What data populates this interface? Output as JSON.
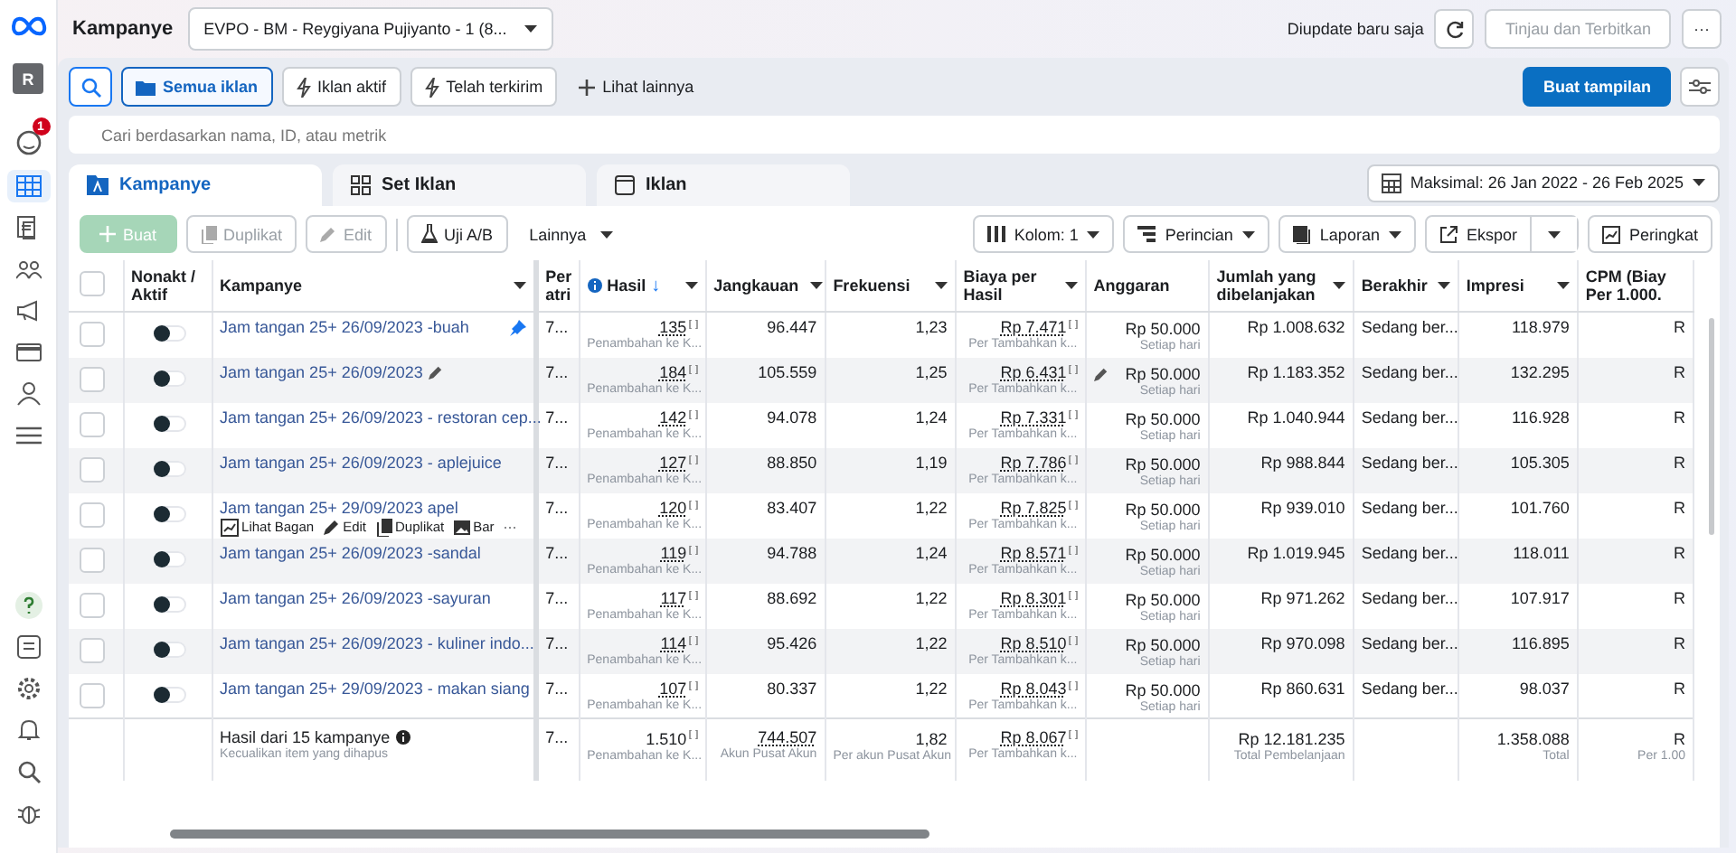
{
  "header": {
    "title": "Kampanye",
    "account": "EVPO - BM - Reygiyana Pujiyanto - 1 (8...",
    "status": "Diupdate baru saja",
    "publish": {
      "label": "Tinjau dan Terbitkan",
      "disabled": true
    },
    "more": "···"
  },
  "sidebar": {
    "avatar": "R",
    "badge": "1",
    "items": [
      {
        "kind": "notify",
        "selected": false
      },
      {
        "kind": "table",
        "selected": true
      },
      {
        "kind": "pages",
        "selected": false
      },
      {
        "kind": "people",
        "selected": false
      },
      {
        "kind": "megaphone",
        "selected": false
      },
      {
        "kind": "card",
        "selected": false
      },
      {
        "kind": "audience",
        "selected": false
      },
      {
        "kind": "menu",
        "selected": false
      }
    ],
    "bottom": [
      {
        "kind": "help"
      },
      {
        "kind": "report"
      },
      {
        "kind": "settings"
      },
      {
        "kind": "bell"
      },
      {
        "kind": "search"
      },
      {
        "kind": "bug"
      }
    ]
  },
  "filters": [
    {
      "label": "Semua iklan",
      "kind": "folder",
      "selected": true
    },
    {
      "label": "Iklan aktif",
      "kind": "bolt",
      "selected": false
    },
    {
      "label": "Telah terkirim",
      "kind": "bolt",
      "selected": false
    },
    {
      "label": "Lihat lainnya",
      "kind": "plus",
      "selected": false
    }
  ],
  "create_view": "Buat tampilan",
  "search": {
    "placeholder": "Cari berdasarkan nama, ID, atau metrik"
  },
  "tabs": [
    {
      "label": "Kampanye",
      "kind": "campaign",
      "selected": true
    },
    {
      "label": "Set Iklan",
      "kind": "adset",
      "selected": false
    },
    {
      "label": "Iklan",
      "kind": "ad",
      "selected": false
    }
  ],
  "date_range": "Maksimal: 26 Jan 2022 - 26 Feb 2025",
  "actions": [
    {
      "label": "Buat",
      "kind": "create",
      "disabled": true
    },
    {
      "label": "Duplikat",
      "kind": "duplicate",
      "disabled": true
    },
    {
      "label": "Edit",
      "kind": "edit",
      "disabled": true
    },
    {
      "label": "Uji A/B",
      "kind": "flask",
      "disabled": false
    },
    {
      "label": "Lainnya",
      "kind": "menu",
      "disabled": false
    }
  ],
  "tools": [
    {
      "label": "Kolom: 1",
      "kind": "columns",
      "caret": true
    },
    {
      "label": "Perincian",
      "kind": "breakdown",
      "caret": true
    },
    {
      "label": "Laporan",
      "kind": "report",
      "caret": true
    },
    {
      "label": "Ekspor",
      "kind": "export",
      "caret": true
    },
    {
      "label": "Peringkat",
      "kind": "chart",
      "caret": false
    }
  ],
  "table": {
    "all_checked": false,
    "columns": [
      {
        "label": "Nonakt / Aktif",
        "sortable": false
      },
      {
        "label": "Kampanye",
        "sortable": true
      },
      {
        "label": "Per atri",
        "sortable": false
      },
      {
        "label": "Hasil",
        "sortable": true,
        "sorted": "↓"
      },
      {
        "label": "Jangkauan",
        "sortable": true
      },
      {
        "label": "Frekuensi",
        "sortable": true
      },
      {
        "label": "Biaya per Hasil",
        "sortable": true
      },
      {
        "label": "Anggaran",
        "sortable": false
      },
      {
        "label": "Jumlah yang dibelanjakan",
        "sortable": true
      },
      {
        "label": "Berakhir",
        "sortable": true
      },
      {
        "label": "Impresi",
        "sortable": true
      },
      {
        "label": "CPM (Biay Per 1.000.",
        "sortable": false
      }
    ],
    "rows": [
      {
        "checked": false,
        "on": false,
        "name": "Jam tangan 25+ 26/09/2023 -buah",
        "pinned": true,
        "editing": false,
        "attr": "7...",
        "results": "135",
        "results_sub": "Penambahan ke K...",
        "reach": "96.447",
        "frequency": "1,23",
        "cost": "Rp 7.471",
        "cost_sub": "Per Tambahkan k...",
        "budget": "Rp 50.000",
        "budget_sub": "Setiap hari",
        "spent": "Rp 1.008.632",
        "ends": "Sedang ber...",
        "impressions": "118.979",
        "cpm": "R"
      },
      {
        "checked": false,
        "on": false,
        "name": "Jam tangan 25+ 26/09/2023",
        "pinned": false,
        "editing": true,
        "attr": "7...",
        "results": "184",
        "results_sub": "Penambahan ke K...",
        "reach": "105.559",
        "frequency": "1,25",
        "cost": "Rp 6.431",
        "cost_sub": "Per Tambahkan k...",
        "budget": "Rp 50.000",
        "budget_sub": "Setiap hari",
        "spent": "Rp 1.183.352",
        "ends": "Sedang ber...",
        "impressions": "132.295",
        "cpm": "R"
      },
      {
        "checked": false,
        "on": false,
        "name": "Jam tangan 25+ 26/09/2023 - restoran cep...",
        "pinned": false,
        "editing": false,
        "attr": "7...",
        "results": "142",
        "results_sub": "Penambahan ke K...",
        "reach": "94.078",
        "frequency": "1,24",
        "cost": "Rp 7.331",
        "cost_sub": "Per Tambahkan k...",
        "budget": "Rp 50.000",
        "budget_sub": "Setiap hari",
        "spent": "Rp 1.040.944",
        "ends": "Sedang ber...",
        "impressions": "116.928",
        "cpm": "R"
      },
      {
        "checked": false,
        "on": false,
        "name": "Jam tangan 25+ 26/09/2023 - aplejuice",
        "pinned": false,
        "editing": false,
        "attr": "7...",
        "results": "127",
        "results_sub": "Penambahan ke K...",
        "reach": "88.850",
        "frequency": "1,19",
        "cost": "Rp 7.786",
        "cost_sub": "Per Tambahkan k...",
        "budget": "Rp 50.000",
        "budget_sub": "Setiap hari",
        "spent": "Rp 988.844",
        "ends": "Sedang ber...",
        "impressions": "105.305",
        "cpm": "R"
      },
      {
        "checked": false,
        "on": false,
        "name": "Jam tangan 25+ 29/09/2023 apel",
        "pinned": false,
        "editing": false,
        "links": [
          {
            "label": "Lihat Bagan",
            "kind": "chart"
          },
          {
            "label": "Edit",
            "kind": "edit"
          },
          {
            "label": "Duplikat",
            "kind": "duplicate"
          },
          {
            "label": "Bar",
            "kind": "image"
          },
          {
            "label": "···",
            "kind": "more"
          }
        ],
        "attr": "7...",
        "results": "120",
        "results_sub": "Penambahan ke K...",
        "reach": "83.407",
        "frequency": "1,22",
        "cost": "Rp 7.825",
        "cost_sub": "Per Tambahkan k...",
        "budget": "Rp 50.000",
        "budget_sub": "Setiap hari",
        "spent": "Rp 939.010",
        "ends": "Sedang ber...",
        "impressions": "101.760",
        "cpm": "R"
      },
      {
        "checked": false,
        "on": false,
        "name": "Jam tangan 25+ 26/09/2023 -sandal",
        "pinned": false,
        "editing": false,
        "attr": "7...",
        "results": "119",
        "results_sub": "Penambahan ke K...",
        "reach": "94.788",
        "frequency": "1,24",
        "cost": "Rp 8.571",
        "cost_sub": "Per Tambahkan k...",
        "budget": "Rp 50.000",
        "budget_sub": "Setiap hari",
        "spent": "Rp 1.019.945",
        "ends": "Sedang ber...",
        "impressions": "118.011",
        "cpm": "R"
      },
      {
        "checked": false,
        "on": false,
        "name": "Jam tangan 25+ 26/09/2023 -sayuran",
        "pinned": false,
        "editing": false,
        "attr": "7...",
        "results": "117",
        "results_sub": "Penambahan ke K...",
        "reach": "88.692",
        "frequency": "1,22",
        "cost": "Rp 8.301",
        "cost_sub": "Per Tambahkan k...",
        "budget": "Rp 50.000",
        "budget_sub": "Setiap hari",
        "spent": "Rp 971.262",
        "ends": "Sedang ber...",
        "impressions": "107.917",
        "cpm": "R"
      },
      {
        "checked": false,
        "on": false,
        "name": "Jam tangan 25+ 26/09/2023 - kuliner indo...",
        "pinned": false,
        "editing": false,
        "attr": "7...",
        "results": "114",
        "results_sub": "Penambahan ke K...",
        "reach": "95.426",
        "frequency": "1,22",
        "cost": "Rp 8.510",
        "cost_sub": "Per Tambahkan k...",
        "budget": "Rp 50.000",
        "budget_sub": "Setiap hari",
        "spent": "Rp 970.098",
        "ends": "Sedang ber...",
        "impressions": "116.895",
        "cpm": "R"
      },
      {
        "checked": false,
        "on": false,
        "name": "Jam tangan 25+ 29/09/2023 - makan siang",
        "pinned": false,
        "editing": false,
        "attr": "7...",
        "results": "107",
        "results_sub": "Penambahan ke K...",
        "reach": "80.337",
        "frequency": "1,22",
        "cost": "Rp 8.043",
        "cost_sub": "Per Tambahkan k...",
        "budget": "Rp 50.000",
        "budget_sub": "Setiap hari",
        "spent": "Rp 860.631",
        "ends": "Sedang ber...",
        "impressions": "98.037",
        "cpm": "R"
      }
    ],
    "footer": {
      "name": "Hasil dari 15 kampanye",
      "name_sub": "Kecualikan item yang dihapus",
      "attr": "7...",
      "results": "1.510",
      "results_sub": "Penambahan ke K...",
      "reach": "744.507",
      "reach_sub": "Akun Pusat Akun",
      "frequency": "1,82",
      "frequency_sub": "Per akun Pusat Akun",
      "cost": "Rp 8.067",
      "cost_sub": "Per Tambahkan k...",
      "spent": "Rp 12.181.235",
      "spent_sub": "Total Pembelanjaan",
      "impressions": "1.358.088",
      "impressions_sub": "Total",
      "cpm": "R",
      "cpm_sub": "Per 1.00"
    }
  }
}
